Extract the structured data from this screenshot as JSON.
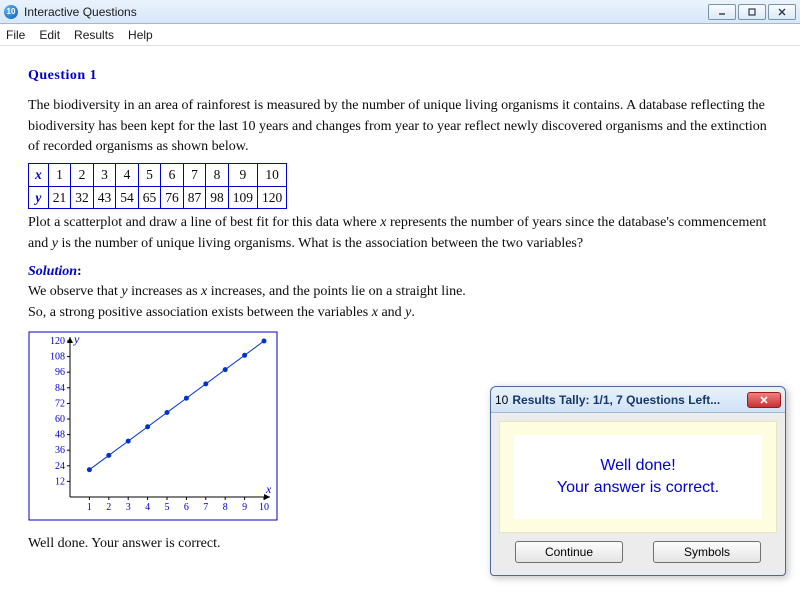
{
  "window": {
    "title": "Interactive Questions",
    "icon_glyph": "10"
  },
  "menu": {
    "items": [
      "File",
      "Edit",
      "Results",
      "Help"
    ]
  },
  "question": {
    "title": "Question 1",
    "body": "The biodiversity in an area of rainforest is measured by the number of unique living organisms it contains. A database reflecting the biodiversity has been kept for the last 10 years and changes from year to year reflect newly discovered organisms and the extinction of recorded organisms as shown below.",
    "table": {
      "row_labels": [
        "x",
        "y"
      ],
      "rows": [
        [
          "1",
          "2",
          "3",
          "4",
          "5",
          "6",
          "7",
          "8",
          "9",
          "10"
        ],
        [
          "21",
          "32",
          "43",
          "54",
          "65",
          "76",
          "87",
          "98",
          "109",
          "120"
        ]
      ]
    },
    "prompt_pre": "Plot a scatterplot and draw a line of best fit for this data where ",
    "prompt_x": "x",
    "prompt_mid": " represents the number of years since the database's commencement and ",
    "prompt_y": "y",
    "prompt_post": " is the number of unique living organisms.  What is the association between the two variables?"
  },
  "solution": {
    "label": "Solution",
    "colon": ":",
    "line1_pre": "We observe that ",
    "line1_y": "y",
    "line1_mid": " increases as ",
    "line1_x": "x",
    "line1_post": " increases, and the points lie on a straight line.",
    "line2_pre": "So, a strong positive association exists between the variables ",
    "line2_x": "x",
    "line2_and": " and ",
    "line2_y": "y",
    "line2_post": "."
  },
  "chart_data": {
    "type": "scatter",
    "x": [
      1,
      2,
      3,
      4,
      5,
      6,
      7,
      8,
      9,
      10
    ],
    "y": [
      21,
      32,
      43,
      54,
      65,
      76,
      87,
      98,
      109,
      120
    ],
    "xlabel": "x",
    "ylabel": "y",
    "xlim": [
      0,
      10
    ],
    "ylim": [
      0,
      120
    ],
    "yticks": [
      12,
      24,
      36,
      48,
      60,
      72,
      84,
      96,
      108,
      120
    ],
    "xticks": [
      1,
      2,
      3,
      4,
      5,
      6,
      7,
      8,
      9,
      10
    ],
    "point_color": "#0033cc",
    "line_of_best_fit": true
  },
  "feedback": "Well done.  Your answer is correct.",
  "popup": {
    "icon_glyph": "10",
    "title": "Results Tally:  1/1, 7 Questions Left...",
    "msg_line1": "Well done!",
    "msg_line2": "Your answer is correct.",
    "continue": "Continue",
    "symbols": "Symbols"
  }
}
